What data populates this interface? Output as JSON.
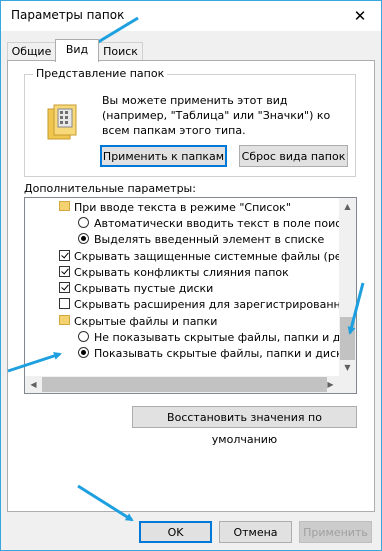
{
  "window": {
    "title": "Параметры папок",
    "close_glyph": "✕"
  },
  "tabs": [
    {
      "label": "Общие"
    },
    {
      "label": "Вид"
    },
    {
      "label": "Поиск"
    }
  ],
  "folder_views": {
    "group_label": "Представление папок",
    "description": "Вы можете применить этот вид (например, \"Таблица\" или \"Значки\") ко всем папкам этого типа.",
    "apply_button": "Применить к папкам",
    "reset_button": "Сброс вида папок"
  },
  "advanced": {
    "label": "Дополнительные параметры:",
    "items": [
      {
        "type": "folder",
        "text": "При вводе текста в режиме \"Список\""
      },
      {
        "type": "radio",
        "checked": false,
        "text": "Автоматически вводить текст в поле поиска"
      },
      {
        "type": "radio",
        "checked": true,
        "text": "Выделять введенный элемент в списке"
      },
      {
        "type": "checkbox",
        "checked": true,
        "text": "Скрывать защищенные системные файлы (рекомен"
      },
      {
        "type": "checkbox",
        "checked": true,
        "text": "Скрывать конфликты слияния папок"
      },
      {
        "type": "checkbox",
        "checked": true,
        "text": "Скрывать пустые диски"
      },
      {
        "type": "checkbox",
        "checked": false,
        "text": "Скрывать расширения для зарегистрированных типо"
      },
      {
        "type": "folder",
        "text": "Скрытые файлы и папки"
      },
      {
        "type": "radio",
        "checked": false,
        "text": "Не показывать скрытые файлы, папки и диски"
      },
      {
        "type": "radio",
        "checked": true,
        "text": "Показывать скрытые файлы, папки и диски"
      }
    ],
    "restore_button": "Восстановить значения по умолчанию"
  },
  "footer": {
    "ok": "OK",
    "cancel": "Отмена",
    "apply": "Применить"
  },
  "colors": {
    "annotation_arrow": "#1ea0e0",
    "window_border": "#3aa7dc"
  }
}
